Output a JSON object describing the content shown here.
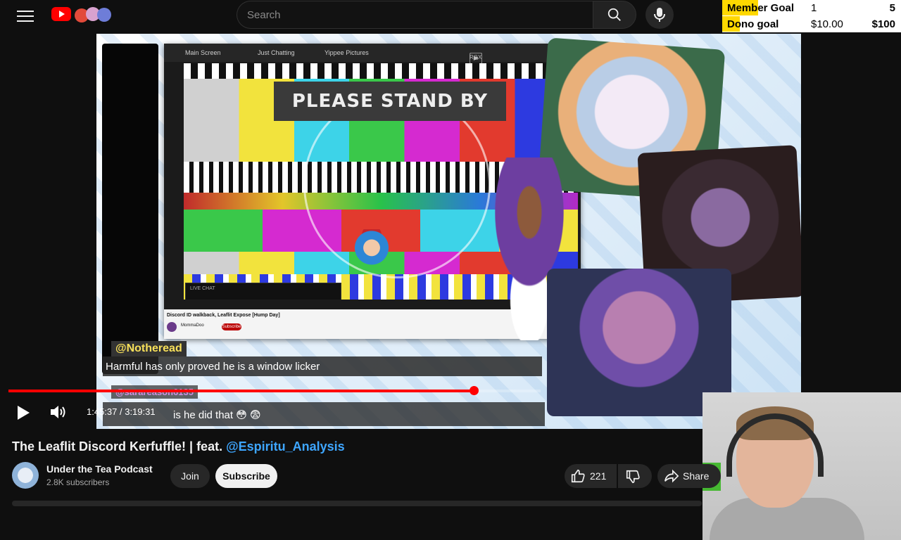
{
  "header": {
    "search_placeholder": "Search"
  },
  "goals": {
    "member": {
      "label": "Member Goal",
      "current": "1",
      "target": "5",
      "progress": 0.2
    },
    "dono": {
      "label": "Dono goal",
      "current": "$10.00",
      "target": "$100",
      "progress": 0.1
    }
  },
  "stream": {
    "tabs": [
      "Main Screen",
      "Just Chatting",
      "Yippee Pictures"
    ],
    "rgx_label": "RGX",
    "standby_text": "PLEASE STAND BY",
    "inner_video_title": "Discord ID walkback, Leaflit Expose [Hump Day]",
    "inner_channel": "MommaDoo",
    "inner_subscribe": "Subscribe",
    "inner_live_chat": "LIVE CHAT"
  },
  "chat": [
    {
      "user": "@Notheread",
      "message": "Harmful has only proved he is a window licker"
    },
    {
      "user": "@sarareason6135",
      "message": "is he did that 😳 😨"
    }
  ],
  "player": {
    "current_time": "1:45:37",
    "duration": "3:19:31",
    "time_display": "1:45:37 / 3:19:31",
    "progress": 0.874
  },
  "video": {
    "title_prefix": "The Leaflit Discord Kerfuffle! | feat. ",
    "title_mention": "@Espiritu_Analysis"
  },
  "channel": {
    "name": "Under the Tea Podcast",
    "subscribers": "2.8K subscribers",
    "join_label": "Join",
    "subscribe_label": "Subscribe"
  },
  "actions": {
    "likes": "221",
    "share_label": "Share"
  },
  "colors": {
    "accent_red": "#ff0000",
    "mention_blue": "#3ea6ff",
    "goal_yellow": "#ffd800"
  }
}
